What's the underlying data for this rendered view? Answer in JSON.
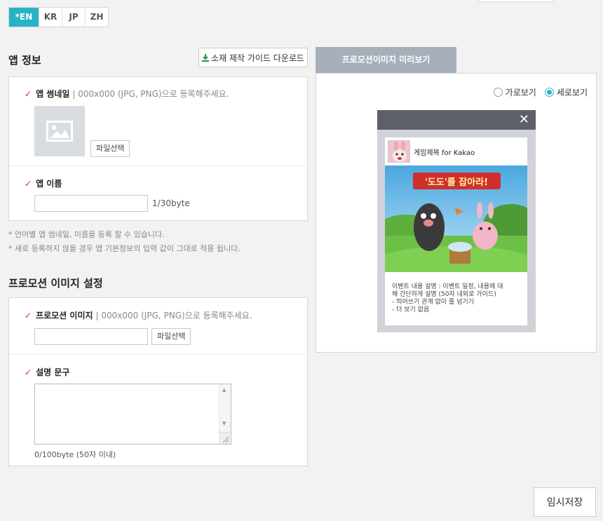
{
  "lang_tabs": [
    "*EN",
    "KR",
    "JP",
    "ZH"
  ],
  "app_info": {
    "title": "앱 정보",
    "guide_button": "소재 제작 가이드 다운로드",
    "thumbnail_label": "앱 썸네일",
    "thumbnail_hint": "| 000x000 (JPG, PNG)으로 등록해주세요.",
    "file_button": "파일선택",
    "name_label": "앱 이름",
    "name_value": "",
    "name_counter": "1/30byte"
  },
  "notes": [
    "* 언어별 앱 썸네일, 이름을 등록 할 수 있습니다.",
    "* 새로 등록하지 않을 경우 앱 기본정보의 입력 값이 그대로 적용 됩니다."
  ],
  "promo": {
    "title": "프로모션 이미지 설정",
    "image_label": "프로모션 이미지",
    "image_hint": "| 000x000 (JPG, PNG)으로 등록해주세요.",
    "file_button": "파일선택",
    "file_value": "",
    "desc_label": "설명 문구",
    "desc_value": "",
    "desc_counter": "0/100byte (50자 이내)"
  },
  "preview": {
    "tab_label": "프로모션이미지 미리보기",
    "radio_landscape": "가로보기",
    "radio_portrait": "세로보기",
    "selected": "세로보기",
    "close_glyph": "✕",
    "game_title": "게임제목 for Kakao",
    "banner_text": "'도도'를 잡아라!",
    "desc_lines": [
      "이벤트 내용 설명 : 이벤트 일정, 내용에 대",
      "해 간단하게 설명 (50자 내외로 가이드)",
      "- 띄어쓰기 관계 없이 줄 넘기기",
      "- 더 보기 없음"
    ]
  },
  "save_button": "임시저장",
  "colors": {
    "accent": "#28b3c5",
    "preview_tab": "#a7afbb",
    "check": "#c0392b"
  }
}
